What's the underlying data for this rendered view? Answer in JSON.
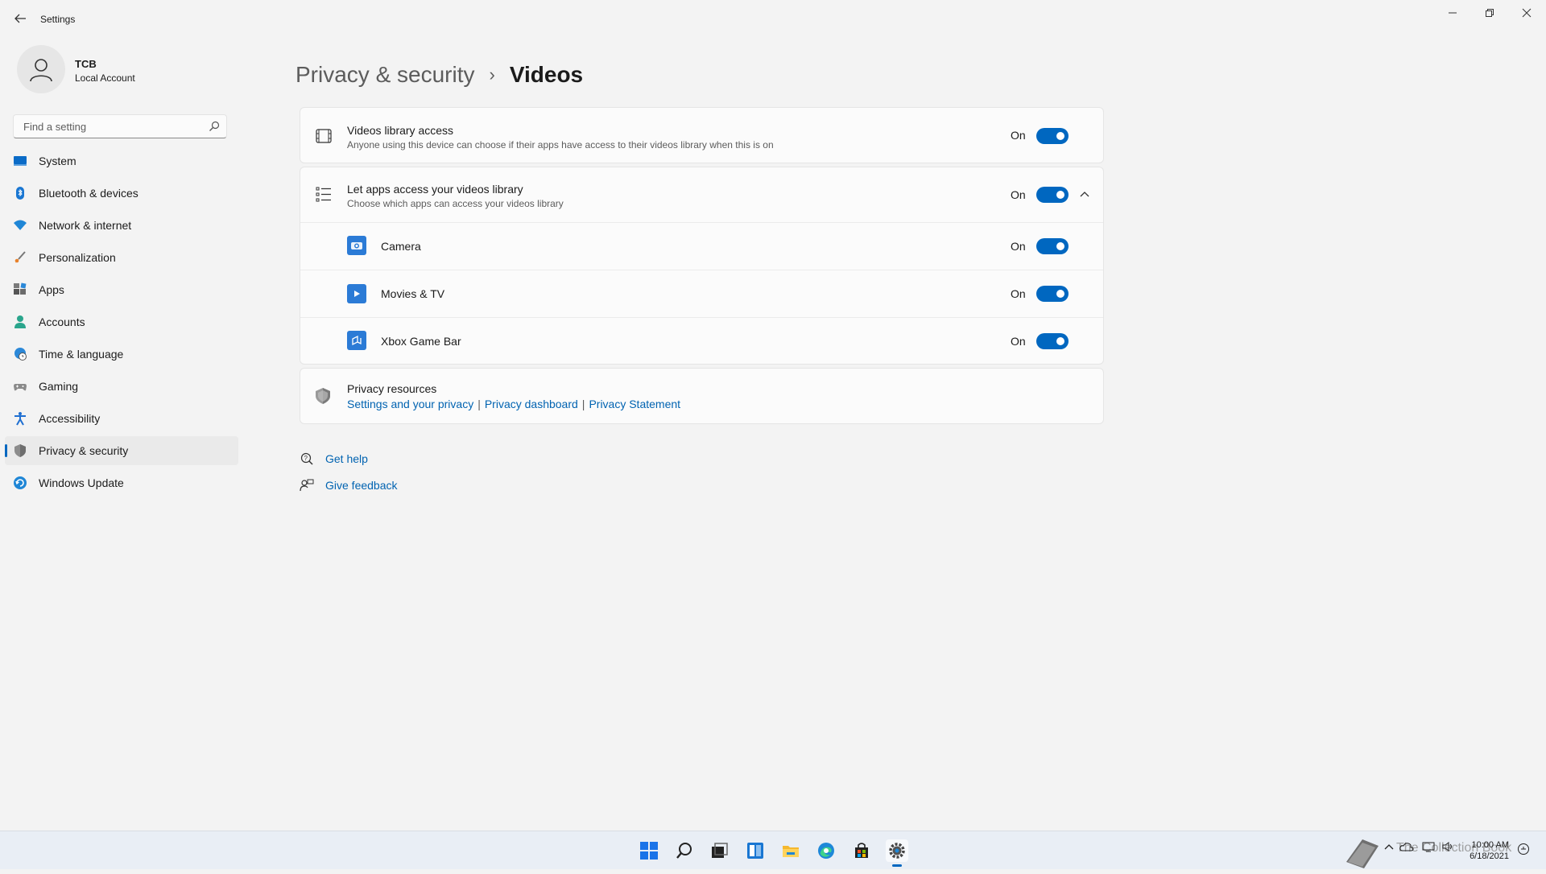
{
  "window": {
    "title": "Settings",
    "controls": [
      "minimize-icon",
      "restore-icon",
      "close-icon"
    ]
  },
  "profile": {
    "name": "TCB",
    "account_type": "Local Account"
  },
  "search": {
    "placeholder": "Find a setting"
  },
  "sidebar": {
    "items": [
      {
        "label": "System",
        "icon": "system-icon"
      },
      {
        "label": "Bluetooth & devices",
        "icon": "bluetooth-icon"
      },
      {
        "label": "Network & internet",
        "icon": "wifi-icon"
      },
      {
        "label": "Personalization",
        "icon": "brush-icon"
      },
      {
        "label": "Apps",
        "icon": "apps-icon"
      },
      {
        "label": "Accounts",
        "icon": "person-icon"
      },
      {
        "label": "Time & language",
        "icon": "globe-clock-icon"
      },
      {
        "label": "Gaming",
        "icon": "gamepad-icon"
      },
      {
        "label": "Accessibility",
        "icon": "accessibility-icon"
      },
      {
        "label": "Privacy & security",
        "icon": "shield-icon",
        "active": true
      },
      {
        "label": "Windows Update",
        "icon": "update-icon"
      }
    ]
  },
  "breadcrumb": {
    "parent": "Privacy & security",
    "separator": "›",
    "current": "Videos"
  },
  "videos_library_access": {
    "title": "Videos library access",
    "description": "Anyone using this device can choose if their apps have access to their videos library when this is on",
    "state": "On",
    "enabled": true
  },
  "apps_access": {
    "title": "Let apps access your videos library",
    "description": "Choose which apps can access your videos library",
    "state": "On",
    "enabled": true,
    "expanded": true,
    "apps": [
      {
        "name": "Camera",
        "state": "On",
        "enabled": true,
        "icon": "camera-app-icon"
      },
      {
        "name": "Movies & TV",
        "state": "On",
        "enabled": true,
        "icon": "movies-tv-app-icon"
      },
      {
        "name": "Xbox Game Bar",
        "state": "On",
        "enabled": true,
        "icon": "xbox-game-bar-app-icon"
      }
    ]
  },
  "privacy_resources": {
    "title": "Privacy resources",
    "links": [
      "Settings and your privacy",
      "Privacy dashboard",
      "Privacy Statement"
    ],
    "separator": "|"
  },
  "help_links": {
    "get_help": "Get help",
    "give_feedback": "Give feedback"
  },
  "taskbar": {
    "icons": [
      "start-icon",
      "search-icon",
      "task-view-icon",
      "widgets-icon",
      "file-explorer-icon",
      "edge-icon",
      "store-icon",
      "settings-icon"
    ],
    "active": "settings-icon",
    "clock": {
      "time": "10:00 AM",
      "date": "6/18/2021"
    },
    "watermark": "The Collection Book"
  },
  "colors": {
    "accent": "#0067c0",
    "background": "#f3f3f3",
    "card": "#fbfbfb",
    "link": "#0063b1"
  }
}
